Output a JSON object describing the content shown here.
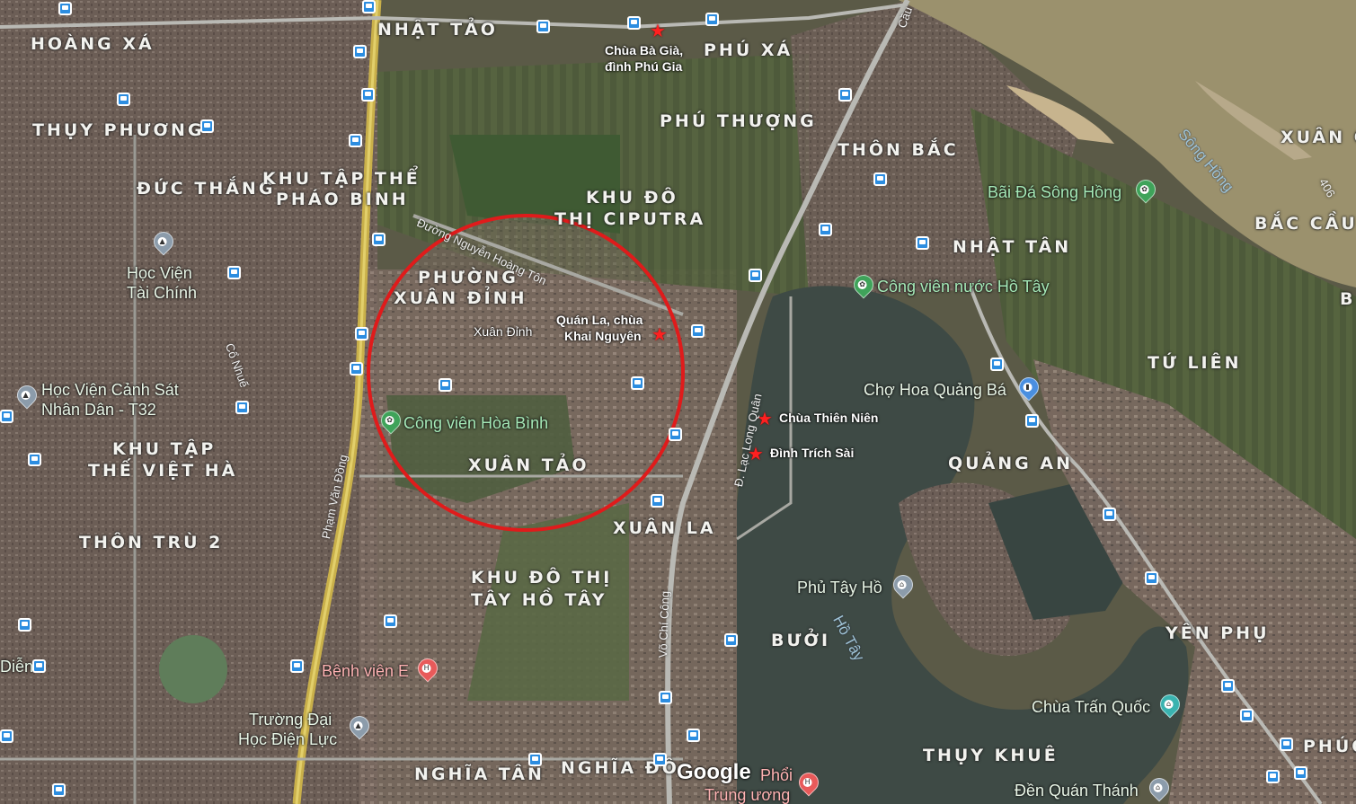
{
  "map": {
    "districts": {
      "hoang_xa": "HOÀNG XÁ",
      "nhat_tao": "NHẬT TẢO",
      "phu_xa": "PHÚ XÁ",
      "thuy_phuong": "THỤY PHƯƠNG",
      "phu_thuong": "PHÚ THƯỢNG",
      "thon_bac": "THÔN BẮC",
      "xuan_ca": "XUÂN CA",
      "duc_thang": "ĐỨC THẮNG",
      "kttphao_binh_1": "KHU TẬP THỂ",
      "kttphao_binh_2": "PHÁO BINH",
      "kdt_ciputra_1": "KHU ĐÔ",
      "kdt_ciputra_2": "THỊ CIPUTRA",
      "bac_cau": "BẮC CẦU",
      "nhat_tan": "NHẬT TÂN",
      "phuong_xuan_dinh_1": "PHƯỜNG",
      "phuong_xuan_dinh_2": "XUÂN ĐỈNH",
      "tu_lien": "TỨ LIÊN",
      "kttviet_ha_1": "KHU TẬP",
      "kttviet_ha_2": "THẾ VIỆT HÀ",
      "xuan_tao": "XUÂN TẢO",
      "quang_an": "QUẢNG AN",
      "xuan_la": "XUÂN LA",
      "thon_tru_2": "THÔN TRÙ 2",
      "kdt_tay_ho_tay_1": "KHU ĐÔ THỊ",
      "kdt_tay_ho_tay_2": "TÂY HỒ TÂY",
      "yen_phu": "YÊN PHỤ",
      "buoi": "BƯỞI",
      "thuy_khue": "THỤY KHUÊ",
      "nghia_tan": "NGHĨA TÂN",
      "nghia_do": "NGHĨA ĐÔ",
      "phuc": "PHÚC",
      "b_edge": "B"
    },
    "pois": {
      "hoc_vien_tai_chinh_1": "Học Viện",
      "hoc_vien_tai_chinh_2": "Tài Chính",
      "hoc_vien_csnd_1": "Học Viện Cảnh Sát",
      "hoc_vien_csnd_2": "Nhân Dân - T32",
      "bai_da_song_hong": "Bãi Đá Sông Hồng",
      "cong_vien_nuoc": "Công viên nước Hồ Tây",
      "cong_vien_hoa_binh": "Công viên Hòa Bình",
      "cho_hoa_quang_ba": "Chợ Hoa Quảng Bá",
      "phu_tay_ho": "Phủ Tây Hồ",
      "benh_vien_e": "Bệnh viện E",
      "truong_dh_dien_luc_1": "Trường Đại",
      "truong_dh_dien_luc_2": "Học Điện Lực",
      "chua_tran_quoc": "Chùa Trấn Quốc",
      "den_quan_thanh": "Đền Quán Thánh",
      "phoi_tw_1": "Phổi",
      "phoi_tw_2": "Trung ương",
      "dien_edge": "Diễn"
    },
    "annotations": {
      "chua_ba_gia_1": "Chùa Bà Già,",
      "chua_ba_gia_2": "đình Phú Gia",
      "quan_la_1": "Quán La, chùa",
      "quan_la_2": "Khai Nguyên",
      "chua_thien_nien": "Chùa Thiên Niên",
      "dinh_trich_sai": "Đình Trích Sài",
      "xuan_dinh_small": "Xuân Đỉnh"
    },
    "roads": {
      "nguyen_hoang_ton": "Đường Nguyễn Hoàng Tôn",
      "pham_van_dong": "Phạm Văn Đồng",
      "co_nhue": "Cổ Nhuế",
      "lac_long_quan": "Đ. Lạc Long Quân",
      "vo_chi_cong": "Võ Chí Công",
      "cau": "Cầu",
      "route_406": "406"
    },
    "water": {
      "song_hong": "Sông Hồng",
      "ho_tay": "Hồ Tây"
    },
    "logo": "Google",
    "highlight_color": "#e01b1b",
    "accent_colors": {
      "bus": "#2c8de0",
      "star": "#ff2020",
      "park_pin": "#3fa35a",
      "hospital_pin": "#e85a5a",
      "landmark_pin": "#8c9cab"
    }
  }
}
